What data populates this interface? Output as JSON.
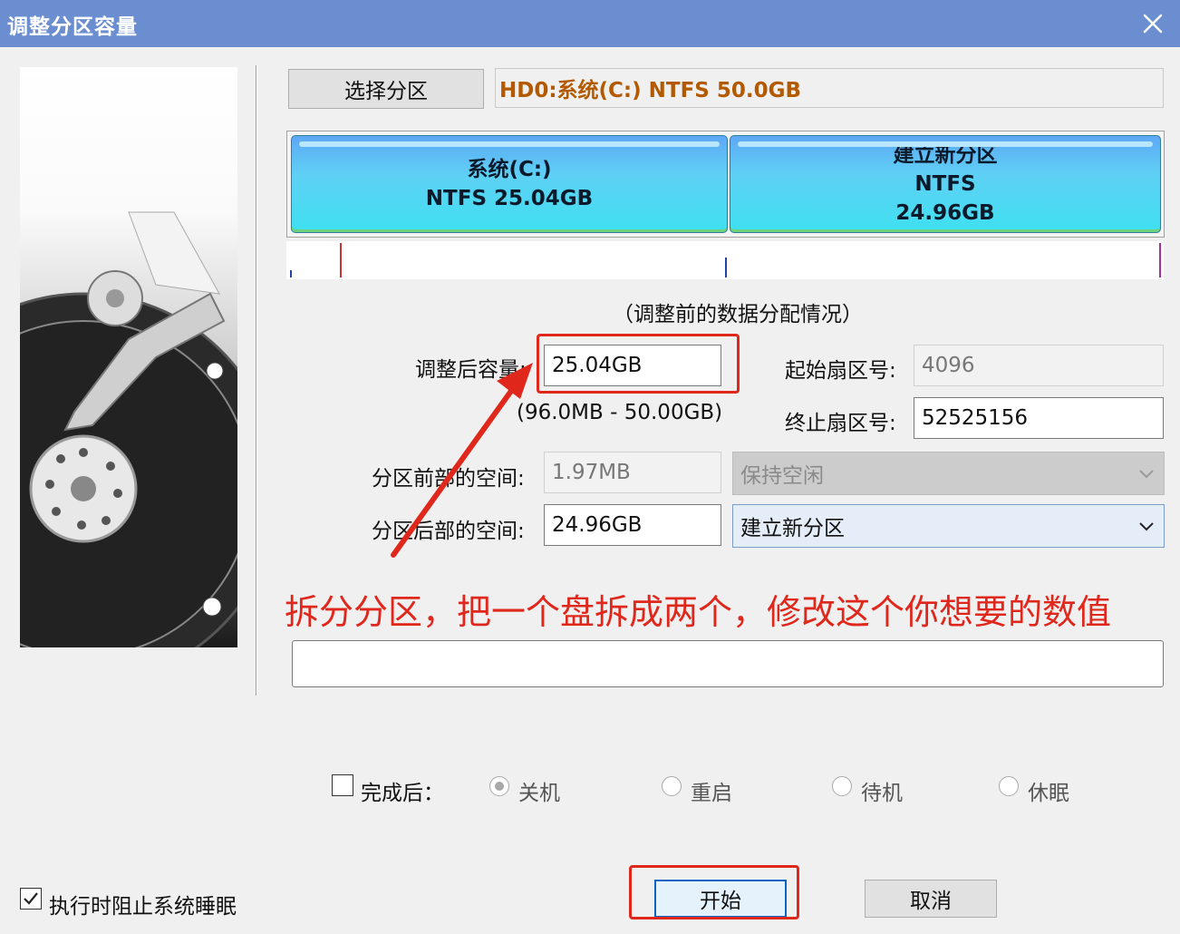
{
  "window": {
    "title": "调整分区容量"
  },
  "select_partition_label": "选择分区",
  "disk_info": "HD0:系统(C:) NTFS 50.0GB",
  "partitions": [
    {
      "lines": [
        "系统(C:)",
        "NTFS 25.04GB"
      ]
    },
    {
      "lines": [
        "建立新分区",
        "NTFS",
        "24.96GB"
      ]
    }
  ],
  "caption": "（调整前的数据分配情况）",
  "form": {
    "size_after_label": "调整后容量:",
    "size_after_value": "25.04GB",
    "size_range": "(96.0MB - 50.00GB)",
    "start_sector_label": "起始扇区号:",
    "start_sector_value": "4096",
    "end_sector_label": "终止扇区号:",
    "end_sector_value": "52525156",
    "space_before_label": "分区前部的空间:",
    "space_before_value": "1.97MB",
    "space_before_action": "保持空闲",
    "space_after_label": "分区后部的空间:",
    "space_after_value": "24.96GB",
    "space_after_action": "建立新分区"
  },
  "annotation": {
    "text": "拆分分区，把一个盘拆成两个，修改这个你想要的数值",
    "color": "#e0271c"
  },
  "after_completion": {
    "label": "完成后：",
    "options": [
      "关机",
      "重启",
      "待机",
      "休眠"
    ],
    "selected": "关机"
  },
  "prevent_sleep_label": "执行时阻止系统睡眠",
  "start_button": "开始",
  "cancel_button": "取消",
  "colors": {
    "titlebar": "#6b8ed0",
    "disk_info": "#b35a00",
    "partition_fill": "#3ee0f0"
  },
  "icons": {
    "close": "close-icon",
    "chevron": "chevron-down-icon",
    "check": "checkmark-icon"
  }
}
